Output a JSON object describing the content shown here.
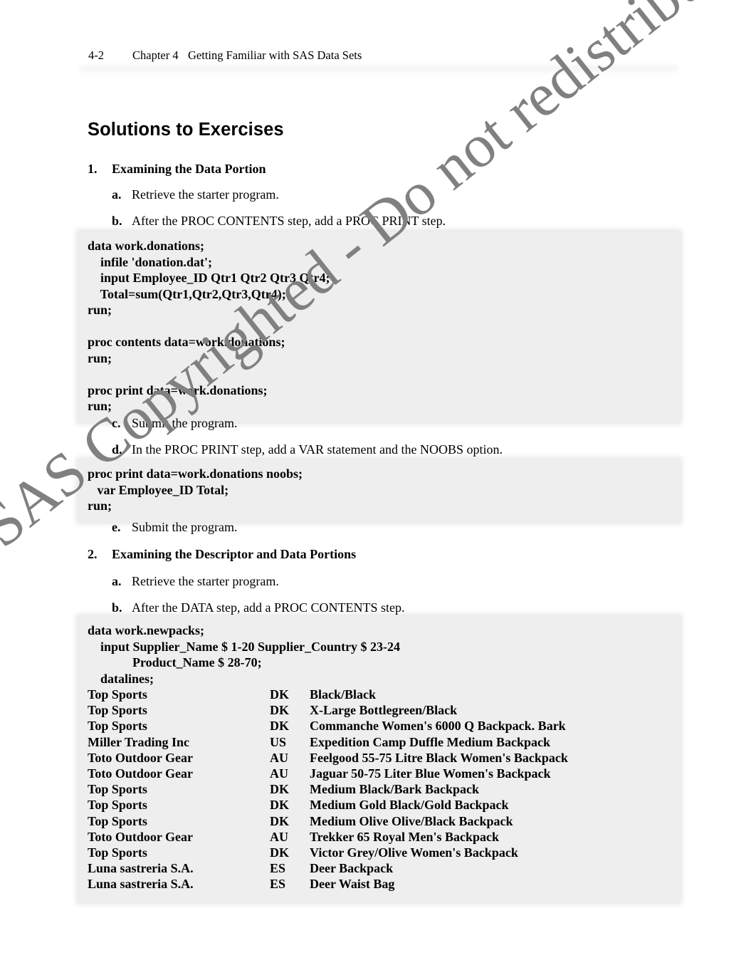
{
  "header": {
    "folio": "4-2",
    "chapter_number": "Chapter 4",
    "chapter_title": "Getting Familiar with SAS Data Sets"
  },
  "watermark": {
    "text": "SAS Copyrighted - Do not redistribute",
    "color": "#808080"
  },
  "title": "Solutions to Exercises",
  "exercises": [
    {
      "marker": "1.",
      "heading": "Examining the Data Portion",
      "steps": [
        {
          "marker": "a.",
          "text": "Retrieve the starter program."
        },
        {
          "marker": "b.",
          "text": "After the PROC CONTENTS step, add a PROC PRINT step."
        },
        {
          "marker": "c.",
          "text": "Submit the program."
        },
        {
          "marker": "d.",
          "text": "In the PROC PRINT step, add a VAR statement and the NOOBS option."
        },
        {
          "marker": "e.",
          "text": "Submit the program."
        }
      ]
    },
    {
      "marker": "2.",
      "heading": "Examining the Descriptor and Data Portions",
      "steps": [
        {
          "marker": "a.",
          "text": "Retrieve the starter program."
        },
        {
          "marker": "b.",
          "text": "After the DATA step, add a PROC CONTENTS step."
        }
      ]
    }
  ],
  "code_blocks": {
    "block1": {
      "lines": [
        "data work.donations;",
        "    infile 'donation.dat';",
        "    input Employee_ID Qtr1 Qtr2 Qtr3 Qtr4;",
        "    Total=sum(Qtr1,Qtr2,Qtr3,Qtr4);",
        "run;",
        "",
        "proc contents data=work.donations;",
        "run;",
        "",
        "proc print data=work.donations;",
        "run;"
      ]
    },
    "block2": {
      "lines": [
        "proc print data=work.donations noobs;",
        "   var Employee_ID Total;",
        "run;"
      ]
    },
    "block3": {
      "lines": [
        "data work.newpacks;",
        "    input Supplier_Name $ 1-20 Supplier_Country $ 23-24",
        "              Product_Name $ 28-70;",
        "    datalines;"
      ],
      "datalines": [
        {
          "supplier": "Top Sports",
          "country": "DK",
          "product": "Black/Black"
        },
        {
          "supplier": "Top Sports",
          "country": "DK",
          "product": "X-Large Bottlegreen/Black"
        },
        {
          "supplier": "Top Sports",
          "country": "DK",
          "product": "Commanche Women's 6000 Q Backpack. Bark"
        },
        {
          "supplier": "Miller Trading Inc",
          "country": "US",
          "product": "Expedition Camp Duffle Medium Backpack"
        },
        {
          "supplier": "Toto Outdoor Gear",
          "country": "AU",
          "product": "Feelgood 55-75 Litre Black Women's Backpack"
        },
        {
          "supplier": "Toto Outdoor Gear",
          "country": "AU",
          "product": "Jaguar 50-75 Liter Blue Women's Backpack"
        },
        {
          "supplier": "Top Sports",
          "country": "DK",
          "product": "Medium Black/Bark Backpack"
        },
        {
          "supplier": "Top Sports",
          "country": "DK",
          "product": "Medium Gold Black/Gold Backpack"
        },
        {
          "supplier": "Top Sports",
          "country": "DK",
          "product": "Medium Olive Olive/Black Backpack"
        },
        {
          "supplier": "Toto Outdoor Gear",
          "country": "AU",
          "product": "Trekker 65 Royal Men's Backpack"
        },
        {
          "supplier": "Top Sports",
          "country": "DK",
          "product": "Victor Grey/Olive Women's Backpack"
        },
        {
          "supplier": "Luna sastreria S.A.",
          "country": "ES",
          "product": "Deer Backpack"
        },
        {
          "supplier": "Luna sastreria S.A.",
          "country": "ES",
          "product": "Deer Waist Bag"
        }
      ]
    }
  }
}
